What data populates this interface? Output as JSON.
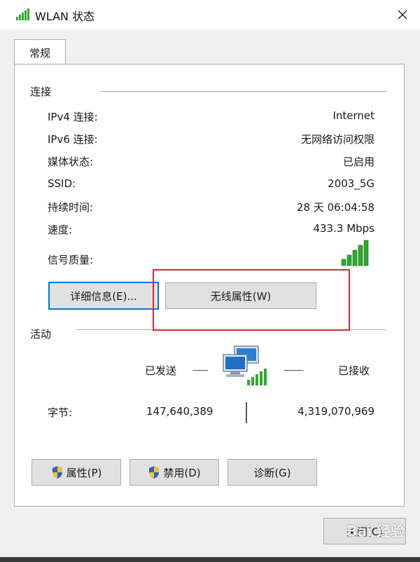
{
  "window": {
    "title": "WLAN 状态",
    "tab": "常规"
  },
  "connection": {
    "section_label": "连接",
    "rows": [
      {
        "label": "IPv4 连接:",
        "value": "Internet"
      },
      {
        "label": "IPv6 连接:",
        "value": "无网络访问权限"
      },
      {
        "label": "媒体状态:",
        "value": "已启用"
      },
      {
        "label": "SSID:",
        "value": "2003_5G"
      },
      {
        "label": "持续时间:",
        "value": "28 天 06:04:58"
      },
      {
        "label": "速度:",
        "value": "433.3 Mbps"
      }
    ],
    "signal_label": "信号质量:",
    "signal_bars": 5,
    "details_button": "详细信息(E)...",
    "wireless_props_button": "无线属性(W)"
  },
  "activity": {
    "section_label": "活动",
    "sent_label": "已发送",
    "received_label": "已接收",
    "bytes_label": "字节:",
    "bytes_sent": "147,640,389",
    "bytes_received": "4,319,070,969"
  },
  "actions": {
    "properties_button": "属性(P)",
    "disable_button": "禁用(D)",
    "diagnose_button": "诊断(G)",
    "close_button": "关闭(C)"
  },
  "watermark": "Bai 经验",
  "colors": {
    "highlight": "#e0242c",
    "focus": "#0078d7",
    "signal": "#2ea82e"
  }
}
